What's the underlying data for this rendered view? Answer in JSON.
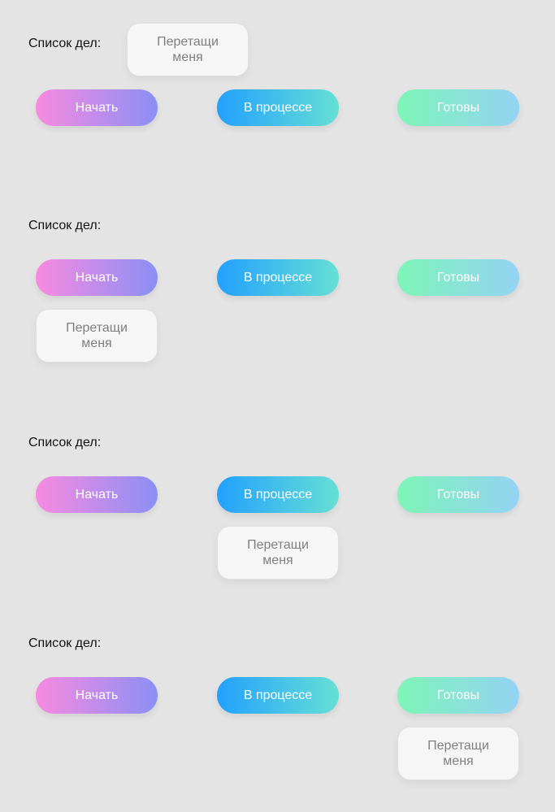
{
  "label": "Список дел:",
  "columns": {
    "start": "Начать",
    "progress": "В процессе",
    "done": "Готовы"
  },
  "card": {
    "line1": "Перетащи",
    "line2": "меня"
  },
  "states": [
    {
      "card_position": "dragging"
    },
    {
      "card_position": "Начать"
    },
    {
      "card_position": "В процессе"
    },
    {
      "card_position": "Готовы"
    }
  ]
}
